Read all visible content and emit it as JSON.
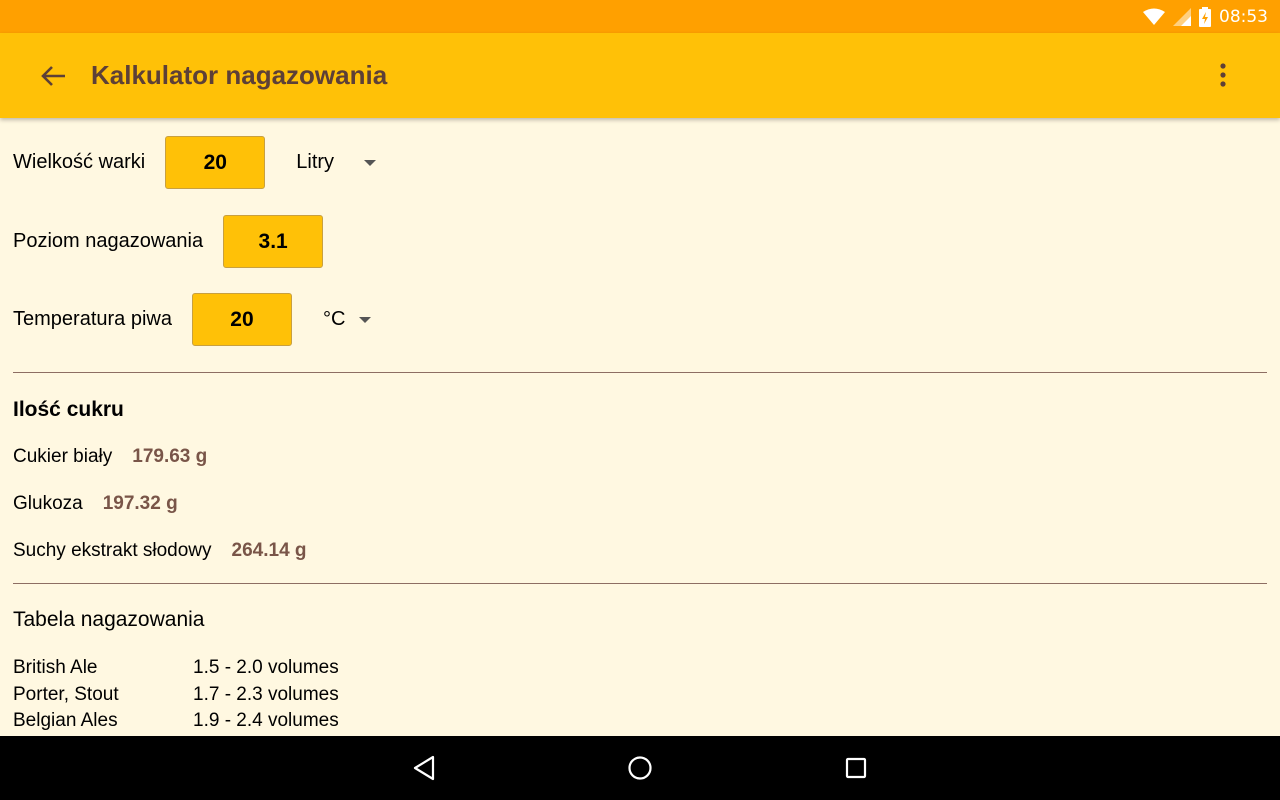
{
  "status_bar": {
    "time": "08:53"
  },
  "app_bar": {
    "title": "Kalkulator nagazowania"
  },
  "inputs": {
    "batch_size": {
      "label": "Wielkość warki",
      "value": "20",
      "unit": "Litry"
    },
    "carbonation_level": {
      "label": "Poziom nagazowania",
      "value": "3.1"
    },
    "beer_temperature": {
      "label": "Temperatura piwa",
      "value": "20",
      "unit": "°C"
    }
  },
  "sugar": {
    "title": "Ilość cukru",
    "items": [
      {
        "label": "Cukier biały",
        "value": "179.63 g"
      },
      {
        "label": "Glukoza",
        "value": "197.32 g"
      },
      {
        "label": "Suchy ekstrakt słodowy",
        "value": "264.14 g"
      }
    ]
  },
  "carbonation_table": {
    "title": "Tabela nagazowania",
    "rows": [
      {
        "style": "British Ale",
        "range": "1.5 - 2.0 volumes"
      },
      {
        "style": "Porter, Stout",
        "range": "1.7 - 2.3 volumes"
      },
      {
        "style": "Belgian Ales",
        "range": "1.9 - 2.4 volumes"
      }
    ]
  },
  "colors": {
    "status_bar": "#ffa000",
    "app_bar": "#ffc107",
    "background": "#fff8e1",
    "title": "#5d4037",
    "result_value": "#795548"
  }
}
